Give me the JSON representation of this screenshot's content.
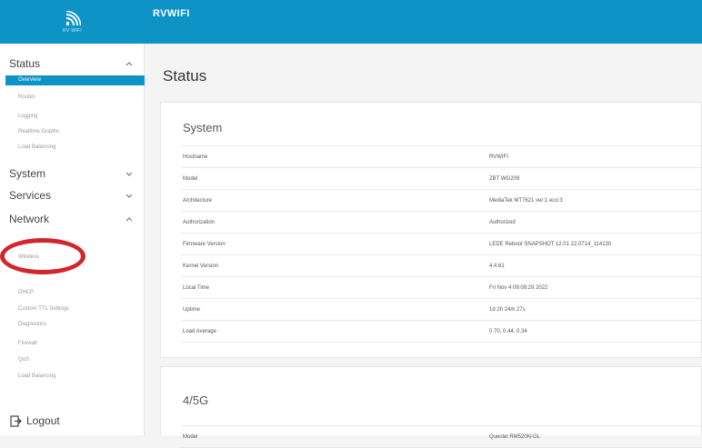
{
  "header": {
    "title": "RVWIFI",
    "brand": "RV WIFI"
  },
  "sidebar": {
    "sections": [
      {
        "label": "Status",
        "expanded": true,
        "items": [
          "Overview",
          "Routes",
          "Logging",
          "Realtime Graphs",
          "Load Balancing"
        ]
      },
      {
        "label": "System",
        "expanded": false
      },
      {
        "label": "Services",
        "expanded": false
      },
      {
        "label": "Network",
        "expanded": true,
        "items": [
          "Wireless",
          "DHCP",
          "Custom TTL Settings",
          "Diagnostics",
          "Firewall",
          "QoS",
          "Load Balancing"
        ]
      }
    ],
    "active_item": "Overview",
    "logout_label": "Logout"
  },
  "main": {
    "page_title": "Status",
    "system": {
      "title": "System",
      "rows": [
        {
          "key": "Hostname",
          "value": "RVWIFI"
        },
        {
          "key": "Model",
          "value": "ZBT WG209"
        },
        {
          "key": "Architecture",
          "value": "MediaTek MT7621 ver:1 eco:3"
        },
        {
          "key": "Authorization",
          "value": "Authorized"
        },
        {
          "key": "Firmware Version",
          "value": "LEDE Reboot SNAPSHOT 12.01 22.0714_114130"
        },
        {
          "key": "Kernel Version",
          "value": "4.4.61"
        },
        {
          "key": "Local Time",
          "value": "Fri Nov 4 09:09:29 2022"
        },
        {
          "key": "Uptime",
          "value": "1d 2h 24m 27s"
        },
        {
          "key": "Load Average",
          "value": "0.70, 0.44, 0.34"
        }
      ]
    },
    "lte": {
      "title": "4/5G",
      "rows": [
        {
          "key": "Model",
          "value": "Quectel RM520N-GL"
        }
      ]
    }
  },
  "colors": {
    "accent": "#0e93c7",
    "highlight": "#d3252d",
    "authorized": "#6cb63a"
  }
}
